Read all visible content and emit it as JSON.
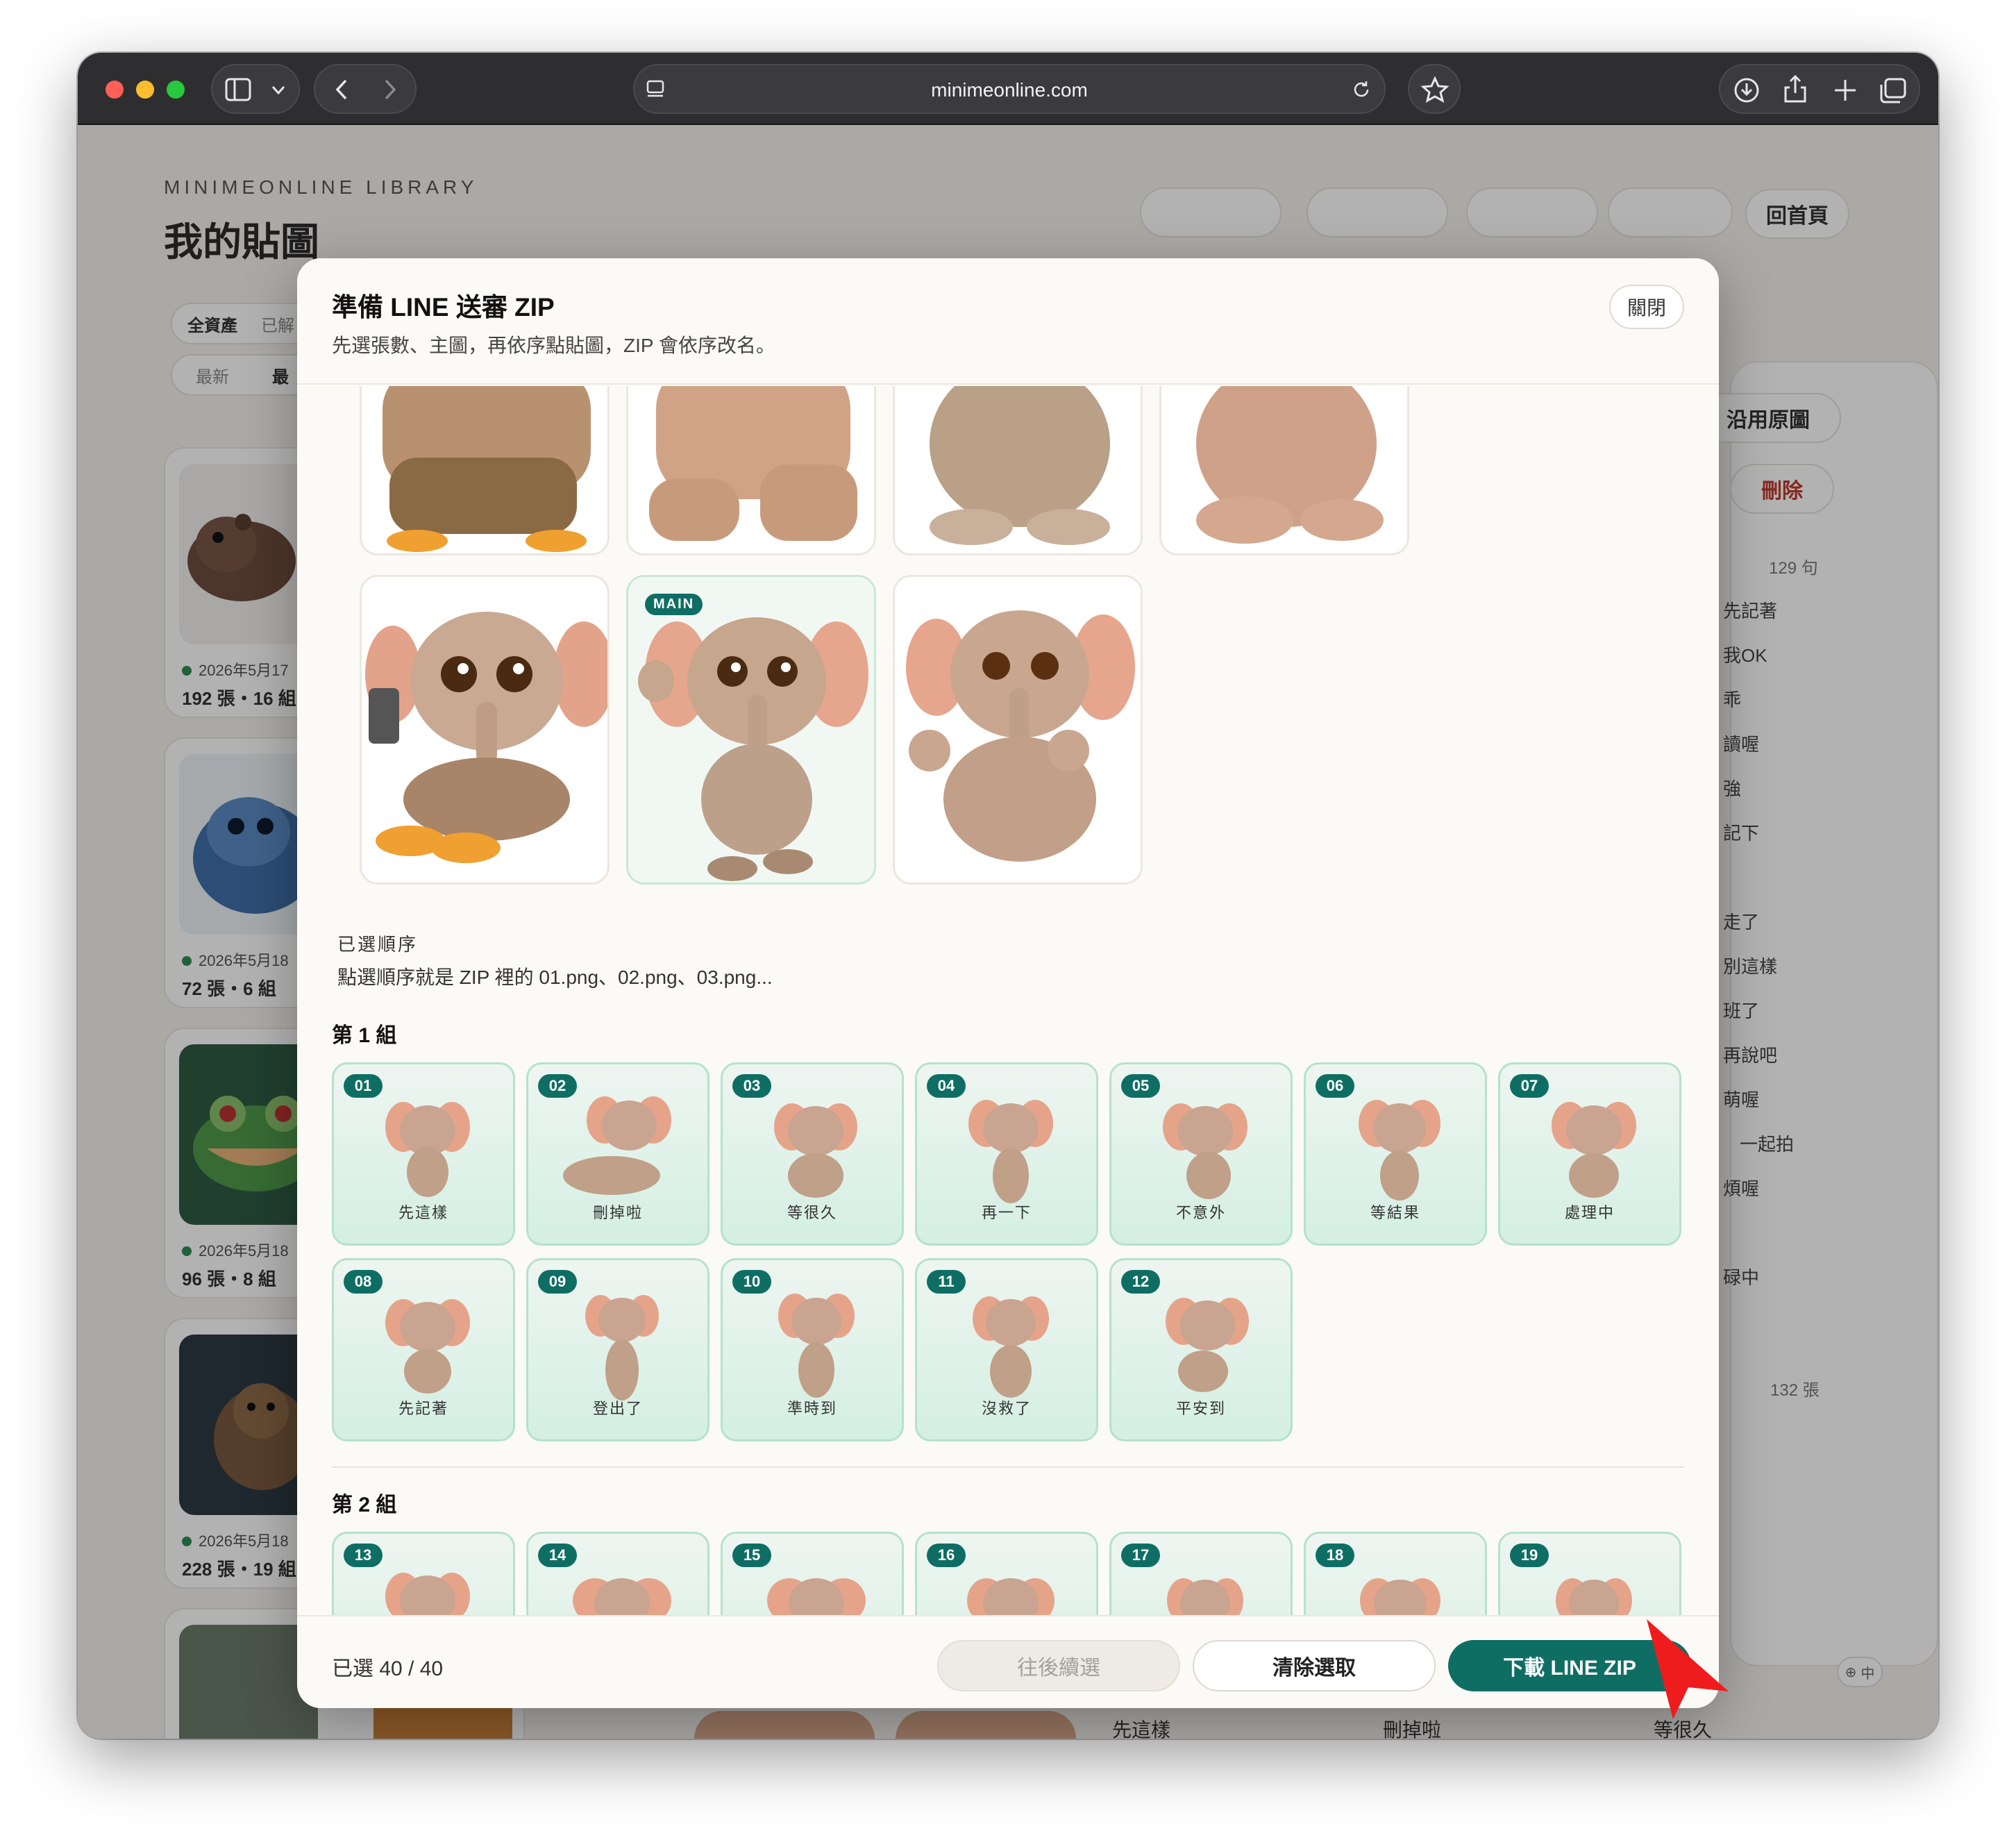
{
  "browser": {
    "url": "minimeonline.com",
    "traffic_lights": [
      "#ff5f57",
      "#febc2e",
      "#28c840"
    ],
    "sidebar_icon": "sidebar-icon",
    "dropdown_icon": "chevron-down-icon",
    "back_icon": "chevron-left-icon",
    "forward_icon": "chevron-right-icon",
    "reader_icon": "reader-icon",
    "reload_icon": "reload-icon",
    "bookmark_icon": "star-icon",
    "download_icon": "download-icon",
    "share_icon": "share-icon",
    "new_tab_icon": "plus-icon",
    "tabs_icon": "tabs-icon"
  },
  "background": {
    "library_label": "MINIMEONLINE LIBRARY",
    "page_title": "我的貼圖",
    "home_button": "回首頁",
    "filter_tabs": [
      "全資產",
      "已解"
    ],
    "sort_tabs": [
      "最新",
      "最"
    ],
    "cards": [
      {
        "date": "2026年5月17",
        "count": "192 張・16 組"
      },
      {
        "date": "2026年5月18",
        "count": "72 張・6 組"
      },
      {
        "date": "2026年5月18",
        "count": "96 張・8 組"
      },
      {
        "date": "2026年5月18",
        "count": "228 張・19 組"
      }
    ],
    "right_panel": {
      "keep_original_button": "沿用原圖",
      "delete_button": "刪除",
      "sentence_count": "129 句",
      "phrases": [
        "先記著",
        "我OK",
        "乖",
        "讀喔",
        "強",
        "記下",
        "走了",
        "別這樣",
        "班了",
        "再說吧",
        "萌喔",
        "一起拍",
        "煩喔",
        "碌中"
      ],
      "image_count": "132 張"
    },
    "bottom_captions": [
      "先這樣",
      "刪掉啦",
      "等很久"
    ],
    "lang_label": "中"
  },
  "modal": {
    "title": "準備 LINE 送審 ZIP",
    "subtitle": "先選張數、主圖，再依序點貼圖，ZIP 會依序改名。",
    "close_button": "關閉",
    "main_badge": "MAIN",
    "order_heading": "已選順序",
    "order_hint": "點選順序就是 ZIP 裡的 01.png、02.png、03.png...",
    "groups": [
      {
        "label": "第 1 組",
        "tiles": [
          {
            "num": "01",
            "caption": "先這樣"
          },
          {
            "num": "02",
            "caption": "刪掉啦"
          },
          {
            "num": "03",
            "caption": "等很久"
          },
          {
            "num": "04",
            "caption": "再一下"
          },
          {
            "num": "05",
            "caption": "不意外"
          },
          {
            "num": "06",
            "caption": "等結果"
          },
          {
            "num": "07",
            "caption": "處理中"
          },
          {
            "num": "08",
            "caption": "先記著"
          },
          {
            "num": "09",
            "caption": "登出了"
          },
          {
            "num": "10",
            "caption": "準時到"
          },
          {
            "num": "11",
            "caption": "沒救了"
          },
          {
            "num": "12",
            "caption": "平安到"
          }
        ]
      },
      {
        "label": "第 2 組",
        "tiles": [
          {
            "num": "13",
            "caption": ""
          },
          {
            "num": "14",
            "caption": ""
          },
          {
            "num": "15",
            "caption": ""
          },
          {
            "num": "16",
            "caption": ""
          },
          {
            "num": "17",
            "caption": ""
          },
          {
            "num": "18",
            "caption": ""
          },
          {
            "num": "19",
            "caption": ""
          }
        ]
      }
    ],
    "footer": {
      "selected_text": "已選 40 / 40",
      "continue_button": "往後續選",
      "clear_button": "清除選取",
      "download_button": "下載 LINE ZIP"
    },
    "accent_color": "#0f6e64"
  }
}
